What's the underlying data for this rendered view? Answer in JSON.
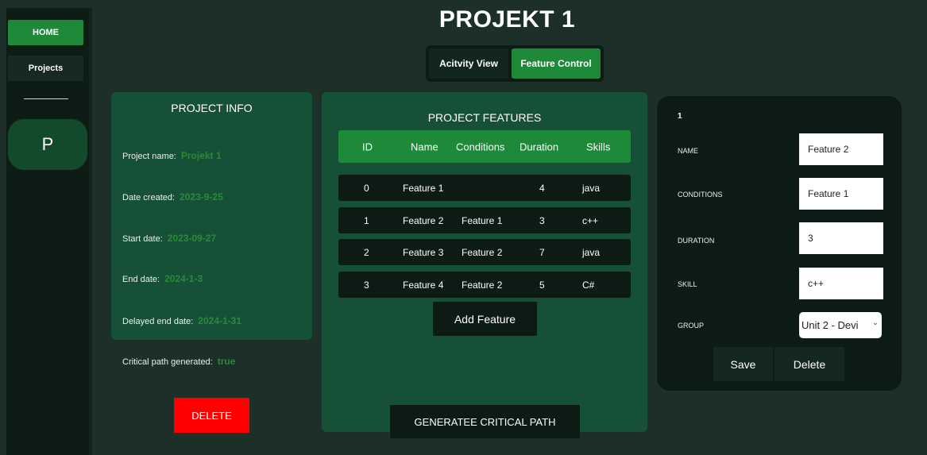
{
  "nav": {
    "home": "HOME",
    "projects": "Projects",
    "project_initial": "P"
  },
  "header": {
    "title": "PROJEKT 1",
    "tabs": [
      "Acitvity View",
      "Feature Control"
    ],
    "active_tab": "Feature Control"
  },
  "project_info": {
    "title": "PROJECT INFO",
    "fields": [
      {
        "label": "Project name:",
        "value": "Projekt 1"
      },
      {
        "label": "Date created:",
        "value": "2023-9-25"
      },
      {
        "label": "Start date:",
        "value": "2023-09-27"
      },
      {
        "label": "End date:",
        "value": "2024-1-3"
      },
      {
        "label": "Delayed end date:",
        "value": "2024-1-31"
      }
    ],
    "critical_label": "Critical path generated:",
    "critical_value": "true",
    "delete_label": "DELETE"
  },
  "features": {
    "title": "PROJECT FEATURES",
    "columns": [
      "ID",
      "Name",
      "Conditions",
      "Duration",
      "Skills"
    ],
    "rows": [
      {
        "id": "0",
        "name": "Feature 1",
        "conditions": "",
        "duration": "4",
        "skills": "java"
      },
      {
        "id": "1",
        "name": "Feature 2",
        "conditions": "Feature 1",
        "duration": "3",
        "skills": "c++"
      },
      {
        "id": "2",
        "name": "Feature 3",
        "conditions": "Feature 2",
        "duration": "7",
        "skills": "java"
      },
      {
        "id": "3",
        "name": "Feature 4",
        "conditions": "Feature 2",
        "duration": "5",
        "skills": "C#"
      }
    ],
    "add_label": "Add Feature",
    "generate_label": "GENERATEE CRITICAL PATH"
  },
  "editor": {
    "id": "1",
    "name_label": "NAME",
    "name_value": "Feature 2",
    "conditions_label": "CONDITIONS",
    "conditions_value": "Feature 1",
    "duration_label": "DURATION",
    "duration_value": "3",
    "skill_label": "SKILL",
    "skill_value": "c++",
    "group_label": "GROUP",
    "group_value": "Unit 2 - Devi",
    "save_label": "Save",
    "delete_label": "Delete"
  },
  "colors": {
    "background": "#1c2f28",
    "accent_green": "#1e8a39",
    "panel_green": "#165036",
    "dark": "#0c1c15",
    "danger": "#ff0000"
  }
}
